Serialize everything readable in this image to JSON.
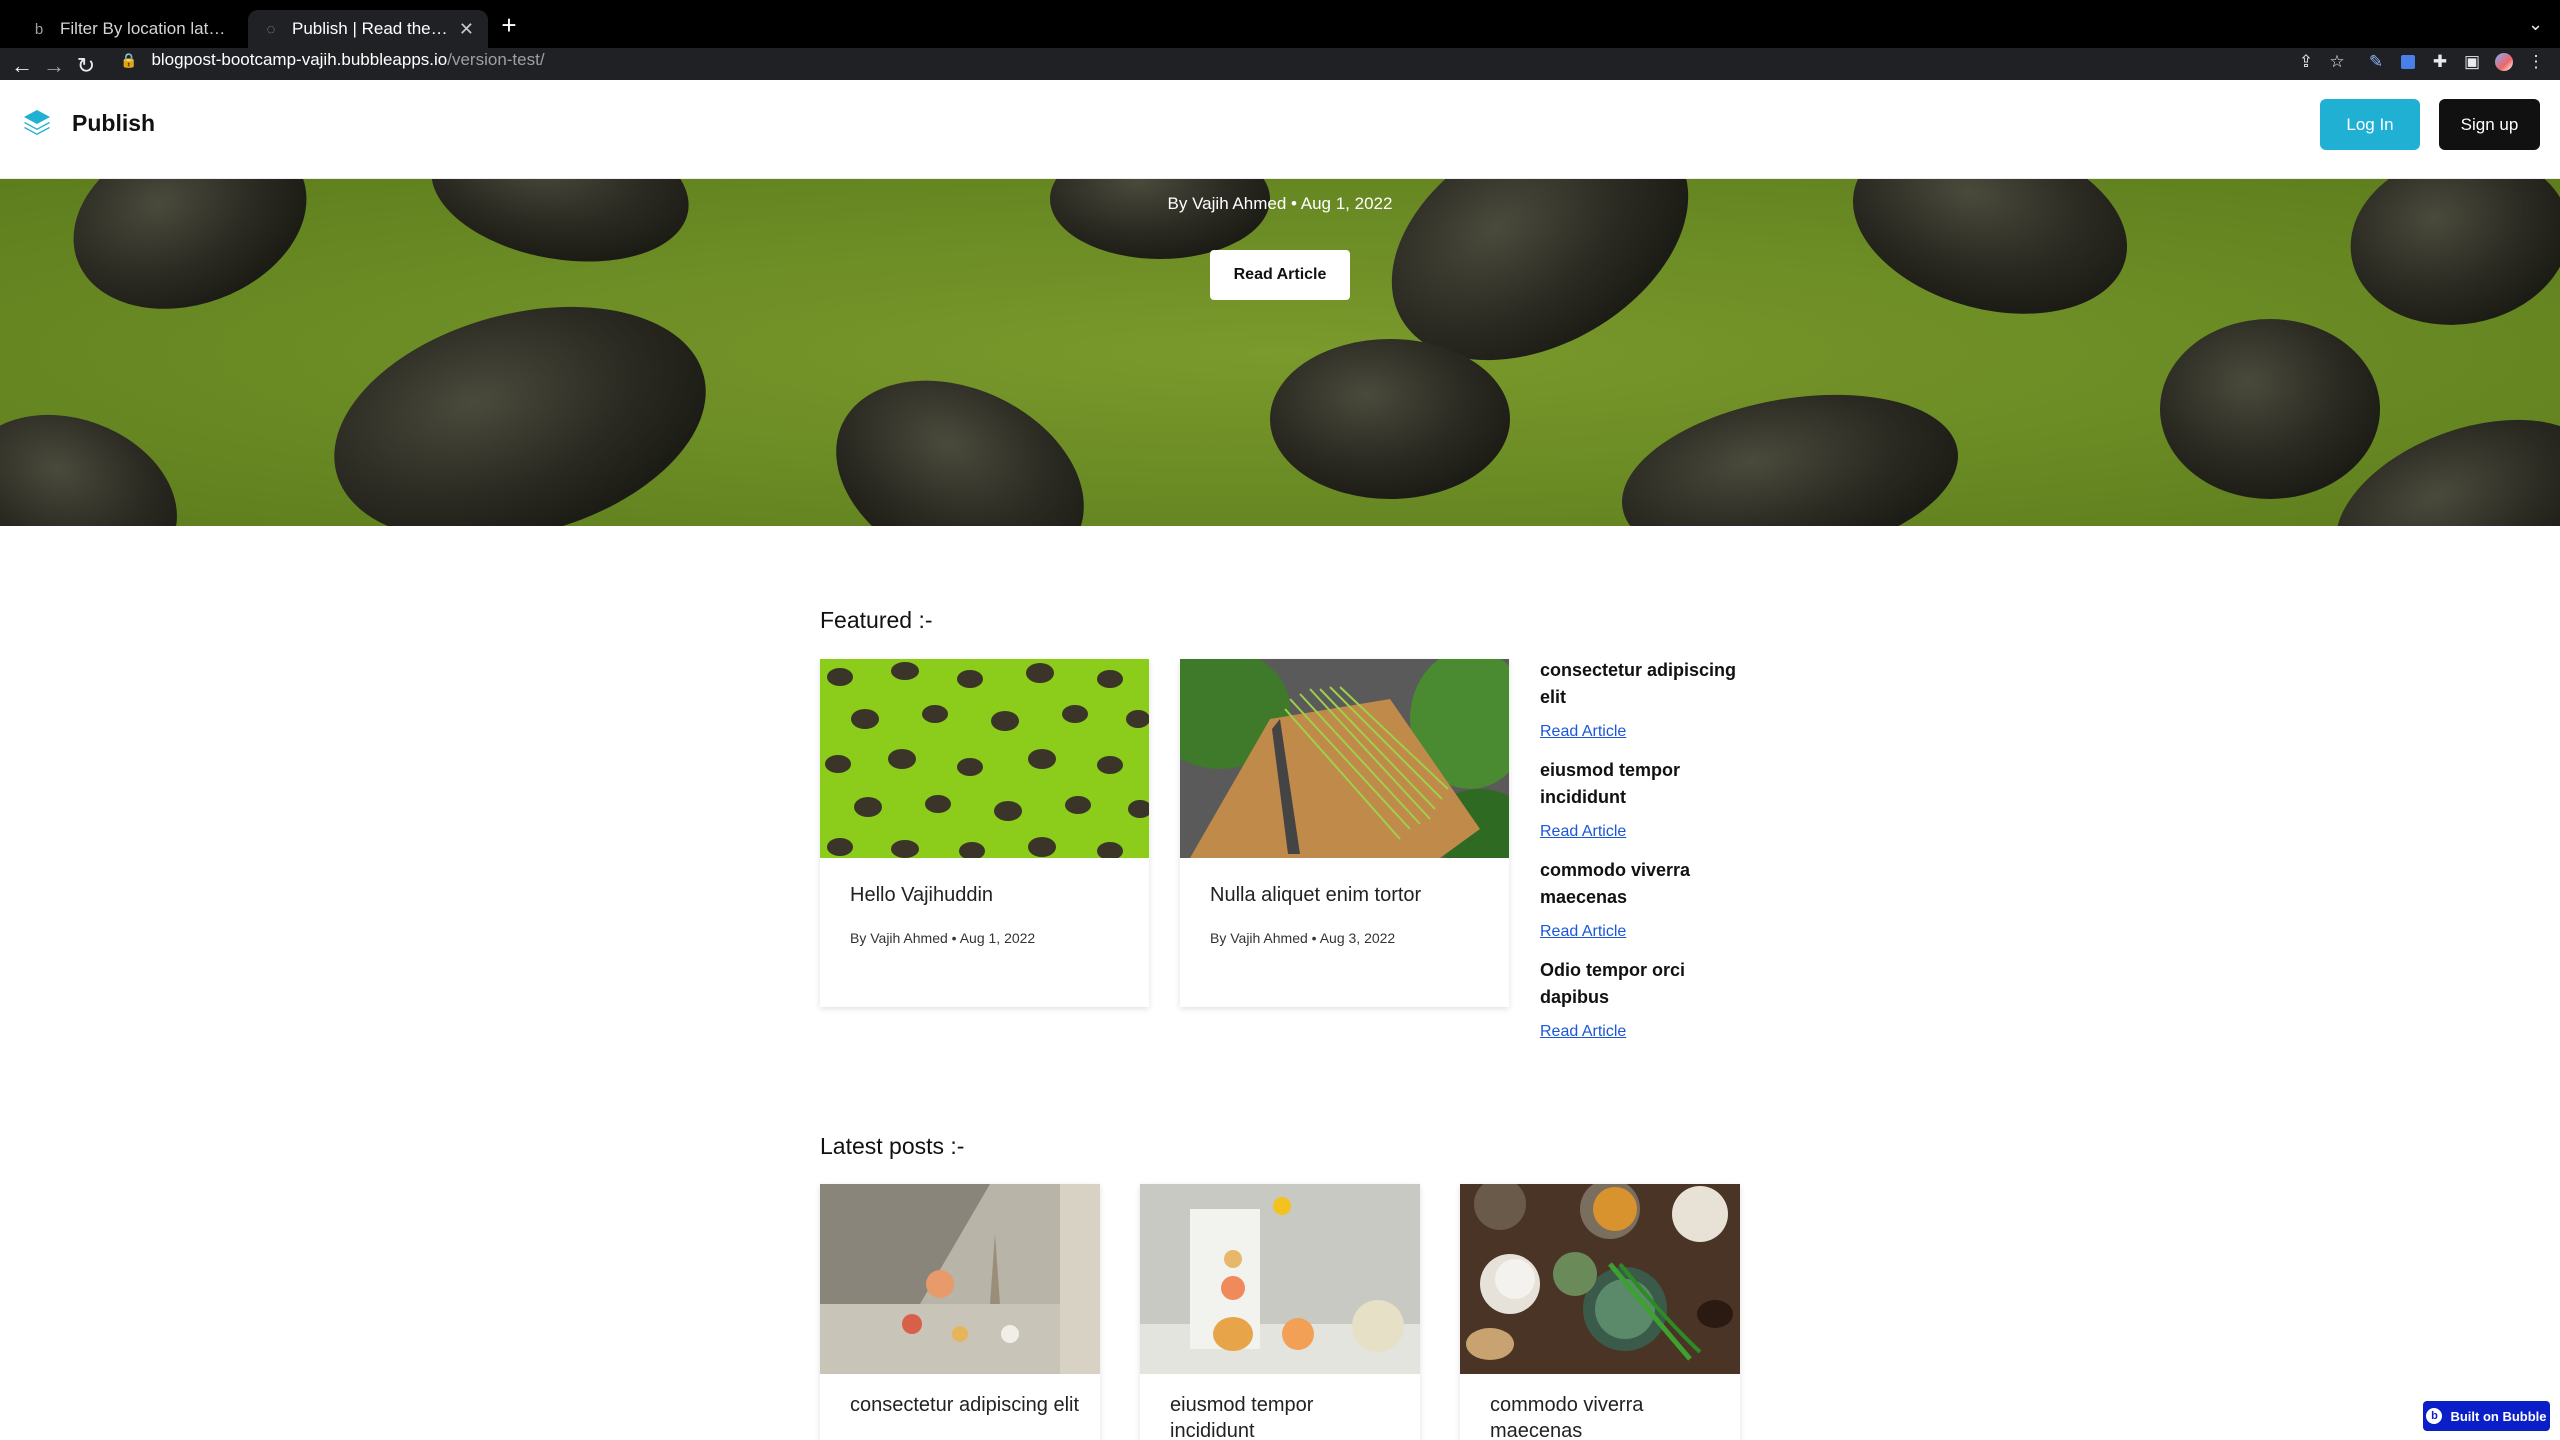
{
  "browser": {
    "tabs": [
      {
        "title": "Filter By location lat and lon - Bu",
        "active": false
      },
      {
        "title": "Publish | Read the best articles",
        "active": true
      }
    ],
    "new_tab_label": "+",
    "url_host": "blogpost-bootcamp-vajih.bubbleapps.io",
    "url_path": "/version-test/"
  },
  "header": {
    "site_name": "Publish",
    "login_label": "Log In",
    "signup_label": "Sign up"
  },
  "hero": {
    "byline": "By Vajih Ahmed • Aug 1, 2022",
    "read_label": "Read Article"
  },
  "featured": {
    "title": "Featured :-",
    "cards": [
      {
        "title": "Hello Vajihuddin",
        "meta": "By Vajih Ahmed • Aug 1, 2022"
      },
      {
        "title": "Nulla aliquet enim tortor",
        "meta": "By Vajih Ahmed • Aug 3, 2022"
      }
    ],
    "side_list": [
      {
        "title": "consectetur adipiscing elit",
        "link": "Read Article"
      },
      {
        "title": "eiusmod tempor incididunt",
        "link": "Read Article"
      },
      {
        "title": "commodo viverra maecenas",
        "link": "Read Article"
      },
      {
        "title": "Odio tempor orci dapibus",
        "link": "Read Article"
      }
    ]
  },
  "latest": {
    "title": "Latest posts :-",
    "cards": [
      {
        "title": "consectetur adipiscing elit"
      },
      {
        "title": "eiusmod tempor incididunt"
      },
      {
        "title": "commodo viverra maecenas"
      }
    ]
  },
  "badge": {
    "label": "Built on Bubble"
  },
  "colors": {
    "login_button": "#1fb0d3",
    "signup_button": "#111111",
    "link": "#1a56db",
    "hero_green": "#6c8a23",
    "bubble_badge": "#0a1fc7"
  },
  "icons": [
    "back-icon",
    "forward-icon",
    "reload-icon",
    "lock-icon",
    "share-icon",
    "star-icon",
    "puzzle-icon",
    "sidebar-icon",
    "profile-icon",
    "menu-icon",
    "logo-layers-icon"
  ]
}
